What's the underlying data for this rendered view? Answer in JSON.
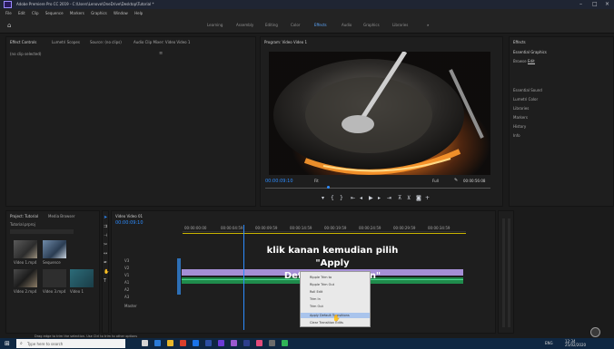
{
  "app": {
    "title": "Adobe Premiere Pro CC 2019 - C:\\Users\\Lenovo\\OneDrive\\Desktop\\Tutorial *"
  },
  "menu": [
    "File",
    "Edit",
    "Clip",
    "Sequence",
    "Markers",
    "Graphics",
    "Window",
    "Help"
  ],
  "workspaces": [
    "Learning",
    "Assembly",
    "Editing",
    "Color",
    "Effects",
    "Audio",
    "Graphics",
    "Libraries"
  ],
  "source_panel": {
    "tabs": [
      "Effect Controls",
      "Lumetri Scopes",
      "Source: (no clips)",
      "Audio Clip Mixer: Video Video 1"
    ],
    "empty_label": "(no clip selected)"
  },
  "program_panel": {
    "title": "Program: Video Video 1",
    "timecode": "00:00:09:10",
    "fit_label": "Fit",
    "quality_label": "Full",
    "duration": "00:00:56:08"
  },
  "effects_panel": {
    "title": "Effects",
    "section": "Essential Graphics",
    "items": [
      "Browse",
      "Edit",
      "Essential Sound",
      "Lumetri Color",
      "Libraries",
      "Markers",
      "History",
      "Info"
    ]
  },
  "project_panel": {
    "tabs": [
      "Project: Tutorial",
      "Media Browser"
    ],
    "file": "Tutorial.prproj",
    "items": [
      "Video 1.mp4",
      "Sequence",
      "Video 2.mp4",
      "Video 3.mp4",
      "Video 1"
    ]
  },
  "timeline": {
    "tab": "Video Video 01",
    "timecode": "00:00:09:10",
    "ruler": [
      "00:00:00:00",
      "00:00:04:59",
      "00:00:09:59",
      "00:00:14:59",
      "00:00:19:59",
      "00:00:24:59",
      "00:00:29:59",
      "00:00:34:59"
    ],
    "tracks_video": [
      "V3",
      "V2",
      "V1"
    ],
    "tracks_audio": [
      "A1",
      "A2",
      "A3"
    ],
    "master_label": "Master"
  },
  "context_menu": {
    "items": [
      "Ripple Trim to",
      "Ripple Trim Out",
      "Roll Edit",
      "Trim In",
      "Trim Out",
      "Apply Default Transitions",
      "Clear Transition Edits"
    ],
    "highlighted_index": 5
  },
  "annotation": {
    "line1": "klik kanan kemudian pilih  \"Apply",
    "line2": "Default Transition\""
  },
  "status": {
    "hint": "Drag edge to trim the selection. Use Ctrl to trim to other options"
  },
  "taskbar": {
    "search_placeholder": "Type here to search",
    "time": "12:34",
    "date": "25/02/2020",
    "lang": "ENG"
  },
  "colors": {
    "accent": "#2d8cff",
    "purple_clip": "#a58fd6",
    "green_clip": "#1f8b4c",
    "taskbar": "#0f2742"
  }
}
